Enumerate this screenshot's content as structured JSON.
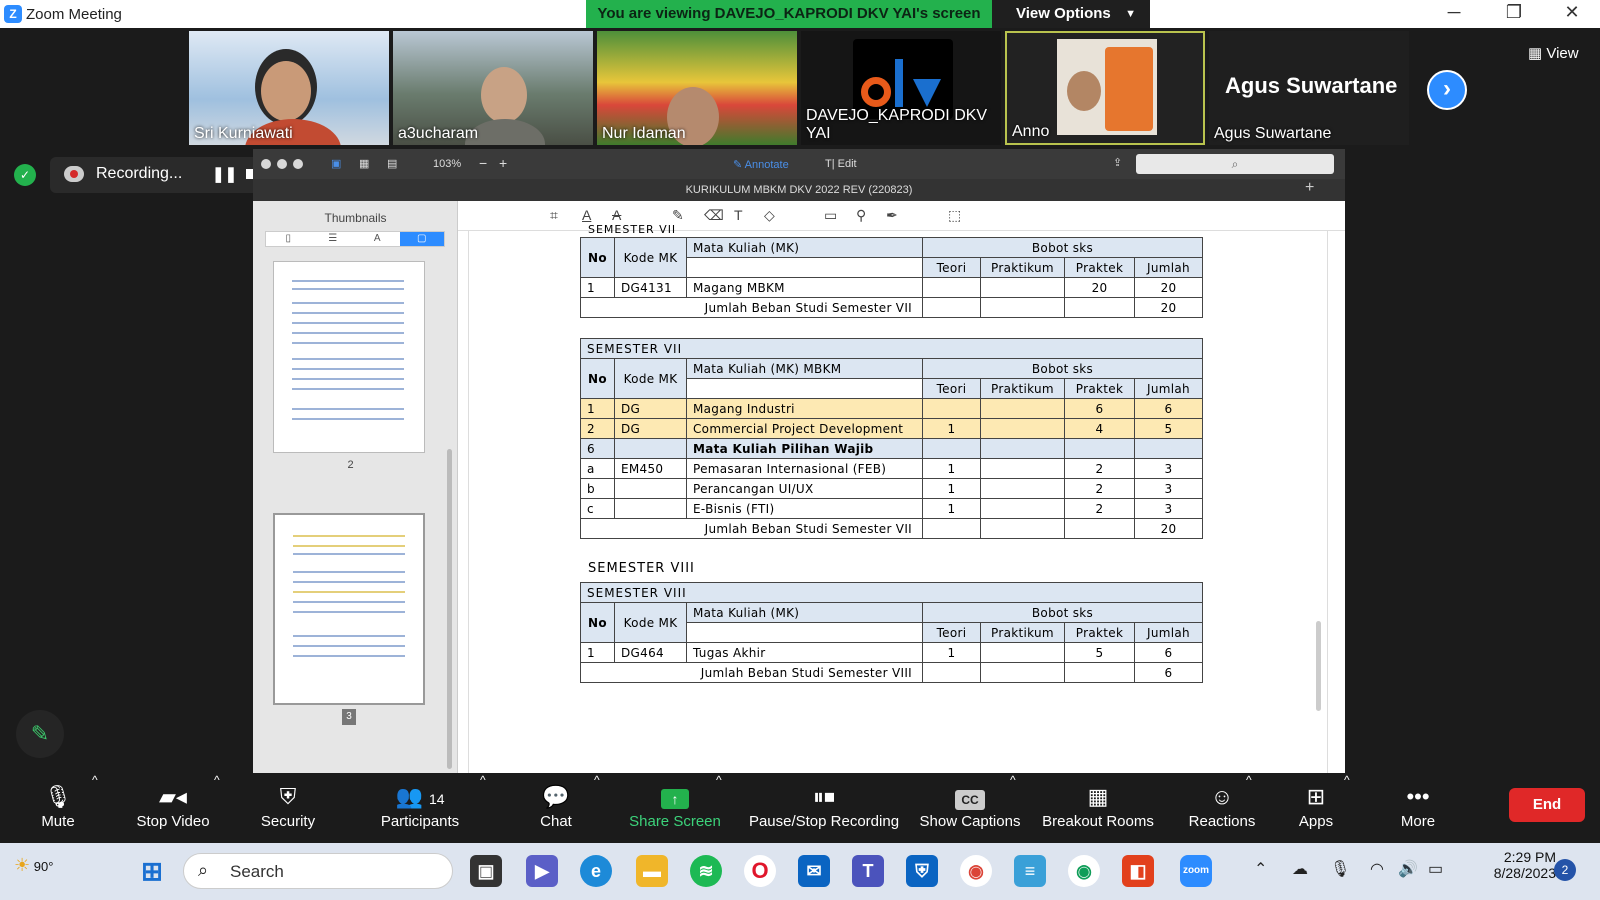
{
  "window": {
    "app_title": "Zoom Meeting",
    "viewing_banner": "You are viewing DAVEJO_KAPRODI DKV YAI's screen",
    "view_options": "View Options"
  },
  "participants": [
    {
      "name": "Sri Kurniawati"
    },
    {
      "name": "a3ucharam"
    },
    {
      "name": "Nur Idaman"
    },
    {
      "name": "DAVEJO_KAPRODI DKV YAI"
    },
    {
      "name": "Anno"
    },
    {
      "name": "Agus Suwartane",
      "big_name": "Agus Suwartane"
    }
  ],
  "view_button": "View",
  "recording": {
    "label": "Recording..."
  },
  "viewer": {
    "doc_title": "KURIKULUM MBKM DKV 2022 REV (220823)",
    "zoom": "103%",
    "annotate": "Annotate",
    "edit": "Edit",
    "thumbnails_label": "Thumbnails",
    "page_numbers": [
      "2",
      "3"
    ]
  },
  "tables": {
    "header": {
      "no": "No",
      "kode": "Kode MK",
      "bobot": "Bobot sks",
      "teori": "Teori",
      "praktikum": "Praktikum",
      "praktek": "Praktek",
      "jumlah": "Jumlah"
    },
    "t1": {
      "top_label": "SEMESTER VII",
      "mk_header": "Mata Kuliah (MK)",
      "rows": [
        {
          "no": "1",
          "kode": "DG4131",
          "mk": "Magang MBKM",
          "teori": "",
          "praktikum": "",
          "praktek": "20",
          "jumlah": "20"
        }
      ],
      "total_label": "Jumlah Beban Studi Semester VII",
      "total": "20"
    },
    "t2": {
      "title": "SEMESTER VII",
      "mk_header": "Mata Kuliah (MK) MBKM",
      "rows": [
        {
          "no": "1",
          "kode": "DG",
          "mk": "Magang Industri",
          "teori": "",
          "praktikum": "",
          "praktek": "6",
          "jumlah": "6",
          "style": "yellow"
        },
        {
          "no": "2",
          "kode": "DG",
          "mk": "Commercial Project Development",
          "teori": "1",
          "praktikum": "",
          "praktek": "4",
          "jumlah": "5",
          "style": "yellow"
        },
        {
          "no": "6",
          "kode": "",
          "mk": "Mata Kuliah Pilihan Wajib",
          "teori": "",
          "praktikum": "",
          "praktek": "",
          "jumlah": "",
          "style": "blue"
        },
        {
          "no": "a",
          "kode": "EM450",
          "mk": "Pemasaran Internasional (FEB)",
          "teori": "1",
          "praktikum": "",
          "praktek": "2",
          "jumlah": "3",
          "style": ""
        },
        {
          "no": "b",
          "kode": "",
          "mk": "Perancangan UI/UX",
          "teori": "1",
          "praktikum": "",
          "praktek": "2",
          "jumlah": "3",
          "style": ""
        },
        {
          "no": "c",
          "kode": "",
          "mk": "E-Bisnis (FTI)",
          "teori": "1",
          "praktikum": "",
          "praktek": "2",
          "jumlah": "3",
          "style": ""
        }
      ],
      "total_label": "Jumlah Beban Studi Semester VII",
      "total": "20"
    },
    "t3": {
      "outer_label": "SEMESTER VIII",
      "title": "SEMESTER VIII",
      "mk_header": "Mata Kuliah (MK)",
      "rows": [
        {
          "no": "1",
          "kode": "DG464",
          "mk": "Tugas Akhir",
          "teori": "1",
          "praktikum": "",
          "praktek": "5",
          "jumlah": "6"
        }
      ],
      "total_label": "Jumlah Beban Studi Semester VIII",
      "total": "6"
    }
  },
  "toolbar": {
    "mute": "Mute",
    "stop_video": "Stop Video",
    "security": "Security",
    "participants": "Participants",
    "participants_count": "14",
    "chat": "Chat",
    "share_screen": "Share Screen",
    "pause_stop": "Pause/Stop Recording",
    "captions": "Show Captions",
    "captions_icon": "CC",
    "breakout": "Breakout Rooms",
    "reactions": "Reactions",
    "apps": "Apps",
    "more": "More",
    "end": "End"
  },
  "taskbar": {
    "weather": "90°",
    "search": "Search",
    "time": "2:29 PM",
    "date": "8/28/2023",
    "notifications": "2"
  },
  "colors": {
    "accent": "#2d8cff",
    "green": "#23b14d",
    "end_red": "#e02828"
  }
}
